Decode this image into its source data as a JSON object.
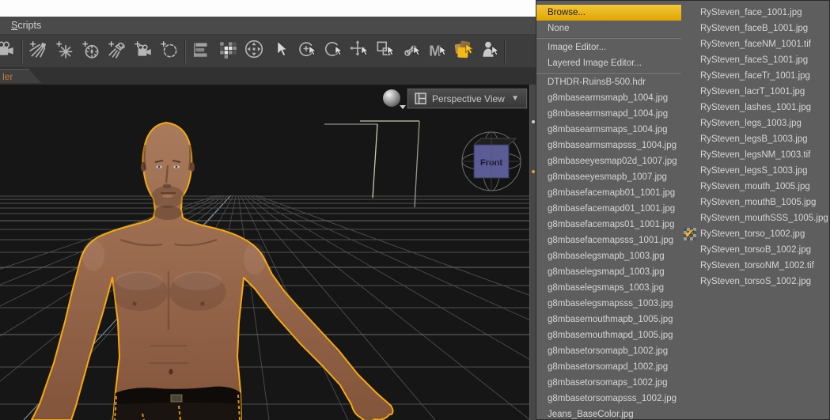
{
  "menubar": {
    "items": [
      {
        "label": "Scripts"
      }
    ]
  },
  "pane_tab": {
    "label": "ler"
  },
  "toolbar": {
    "buttons": [
      {
        "name": "new-camera-icon"
      },
      {
        "type": "separator"
      },
      {
        "name": "create-distant-light-icon"
      },
      {
        "name": "create-point-light-icon"
      },
      {
        "name": "create-sun-light-icon"
      },
      {
        "name": "create-spotlight-icon"
      },
      {
        "name": "create-camera-icon"
      },
      {
        "name": "create-null-icon"
      },
      {
        "type": "separator"
      },
      {
        "name": "scene-pane-icon"
      },
      {
        "name": "tile-layout-icon"
      },
      {
        "name": "viewport-pan-icon"
      },
      {
        "name": "pointer-tool-icon"
      },
      {
        "name": "rotate-orbit-tool-icon"
      },
      {
        "name": "rotate-tool-icon"
      },
      {
        "name": "translate-tool-icon"
      },
      {
        "name": "scale-tool-icon"
      },
      {
        "name": "joint-editor-tool-icon"
      },
      {
        "name": "animate-tool-icon"
      },
      {
        "name": "surface-selection-tool-icon",
        "active": true
      },
      {
        "name": "figure-selection-tool-icon"
      },
      {
        "type": "separator"
      }
    ]
  },
  "viewport": {
    "view_selector_label": "Perspective View",
    "view_cube_label": "Front"
  },
  "context_menu": {
    "column1": [
      {
        "label": "Browse...",
        "highlighted": true
      },
      {
        "label": "None"
      },
      {
        "type": "separator"
      },
      {
        "label": "Image Editor..."
      },
      {
        "label": "Layered Image Editor..."
      },
      {
        "type": "separator"
      },
      {
        "label": "DTHDR-RuinsB-500.hdr"
      },
      {
        "label": "g8mbasearmsmapb_1004.jpg"
      },
      {
        "label": "g8mbasearmsmapd_1004.jpg"
      },
      {
        "label": "g8mbasearmsmaps_1004.jpg"
      },
      {
        "label": "g8mbasearmsmapsss_1004.jpg"
      },
      {
        "label": "g8mbaseeyesmap02d_1007.jpg"
      },
      {
        "label": "g8mbaseeyesmapb_1007.jpg"
      },
      {
        "label": "g8mbasefacemapb01_1001.jpg"
      },
      {
        "label": "g8mbasefacemapd01_1001.jpg"
      },
      {
        "label": "g8mbasefacemaps01_1001.jpg"
      },
      {
        "label": "g8mbasefacemapsss_1001.jpg"
      },
      {
        "label": "g8mbaselegsmapb_1003.jpg"
      },
      {
        "label": "g8mbaselegsmapd_1003.jpg"
      },
      {
        "label": "g8mbaselegsmaps_1003.jpg"
      },
      {
        "label": "g8mbaselegsmapsss_1003.jpg"
      },
      {
        "label": "g8mbasemouthmapb_1005.jpg"
      },
      {
        "label": "g8mbasemouthmapd_1005.jpg"
      },
      {
        "label": "g8mbasetorsomapb_1002.jpg"
      },
      {
        "label": "g8mbasetorsomapd_1002.jpg"
      },
      {
        "label": "g8mbasetorsomaps_1002.jpg"
      },
      {
        "label": "g8mbasetorsomapsss_1002.jpg"
      },
      {
        "label": "Jeans_BaseColor.jpg"
      }
    ],
    "column2": [
      {
        "label": "RySteven_face_1001.jpg"
      },
      {
        "label": "RySteven_faceB_1001.jpg"
      },
      {
        "label": "RySteven_faceNM_1001.tif"
      },
      {
        "label": "RySteven_faceS_1001.jpg"
      },
      {
        "label": "RySteven_faceTr_1001.jpg"
      },
      {
        "label": "RySteven_lacrT_1001.jpg"
      },
      {
        "label": "RySteven_lashes_1001.jpg"
      },
      {
        "label": "RySteven_legs_1003.jpg"
      },
      {
        "label": "RySteven_legsB_1003.jpg"
      },
      {
        "label": "RySteven_legsNM_1003.tif"
      },
      {
        "label": "RySteven_legsS_1003.jpg"
      },
      {
        "label": "RySteven_mouth_1005.jpg"
      },
      {
        "label": "RySteven_mouthB_1005.jpg"
      },
      {
        "label": "RySteven_mouthSSS_1005.jpg"
      },
      {
        "label": "RySteven_torso_1002.jpg",
        "checked": true
      },
      {
        "label": "RySteven_torsoB_1002.jpg"
      },
      {
        "label": "RySteven_torsoNM_1002.tif"
      },
      {
        "label": "RySteven_torsoS_1002.jpg"
      }
    ]
  },
  "colors": {
    "menu_highlight": "#edb81a",
    "menu_background": "#5e5e5e",
    "selection_outline": "#f2a20a",
    "viewport_background": "#161616",
    "skin_tone": "#9a6a50",
    "view_cube_face": "#5b5b96",
    "active_tool_gold": "#f2b818"
  }
}
